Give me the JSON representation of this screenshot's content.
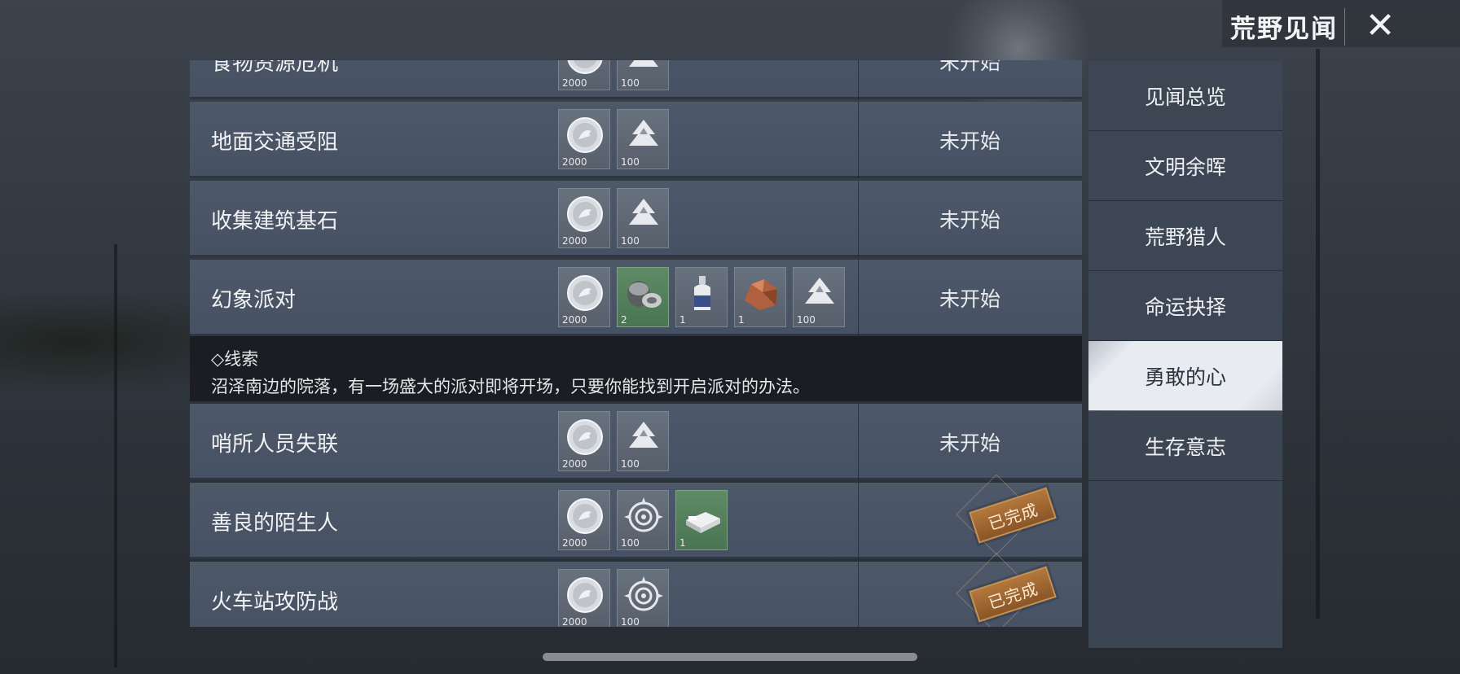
{
  "header": {
    "title": "荒野见闻",
    "close_icon": "close-icon"
  },
  "quests": [
    {
      "name": "食物资源危机",
      "status": "未开始",
      "completed": false,
      "rewards": [
        {
          "icon": "coin-icon",
          "qty": "2000"
        },
        {
          "icon": "tree-icon",
          "qty": "100"
        }
      ]
    },
    {
      "name": "地面交通受阻",
      "status": "未开始",
      "completed": false,
      "rewards": [
        {
          "icon": "coin-icon",
          "qty": "2000"
        },
        {
          "icon": "tree-icon",
          "qty": "100"
        }
      ]
    },
    {
      "name": "收集建筑基石",
      "status": "未开始",
      "completed": false,
      "rewards": [
        {
          "icon": "coin-icon",
          "qty": "2000"
        },
        {
          "icon": "tree-icon",
          "qty": "100"
        }
      ]
    },
    {
      "name": "幻象派对",
      "status": "未开始",
      "completed": false,
      "rewards": [
        {
          "icon": "coin-icon",
          "qty": "2000"
        },
        {
          "icon": "metal-parts-icon",
          "qty": "2",
          "green": true
        },
        {
          "icon": "bottle-icon",
          "qty": "1"
        },
        {
          "icon": "copper-ore-icon",
          "qty": "1"
        },
        {
          "icon": "tree-icon",
          "qty": "100"
        }
      ],
      "clue": {
        "title": "◇线索",
        "text": "沼泽南边的院落，有一场盛大的派对即将开场，只要你能找到开启派对的办法。"
      }
    },
    {
      "name": "哨所人员失联",
      "status": "未开始",
      "completed": false,
      "rewards": [
        {
          "icon": "coin-icon",
          "qty": "2000"
        },
        {
          "icon": "tree-icon",
          "qty": "100"
        }
      ]
    },
    {
      "name": "善良的陌生人",
      "status": "已完成",
      "completed": true,
      "rewards": [
        {
          "icon": "coin-icon",
          "qty": "2000"
        },
        {
          "icon": "target-icon",
          "qty": "100"
        },
        {
          "icon": "bed-icon",
          "qty": "1",
          "green": true
        }
      ]
    },
    {
      "name": "火车站攻防战",
      "status": "已完成",
      "completed": true,
      "rewards": [
        {
          "icon": "coin-icon",
          "qty": "2000"
        },
        {
          "icon": "target-icon",
          "qty": "100"
        }
      ]
    }
  ],
  "sidebar": {
    "items": [
      {
        "label": "见闻总览",
        "active": false
      },
      {
        "label": "文明余晖",
        "active": false
      },
      {
        "label": "荒野猎人",
        "active": false
      },
      {
        "label": "命运抉择",
        "active": false
      },
      {
        "label": "勇敢的心",
        "active": true
      },
      {
        "label": "生存意志",
        "active": false
      }
    ]
  },
  "colors": {
    "active_tab": "#e8ebf0",
    "stamp": "#a56a33",
    "row": "#4b5667"
  }
}
